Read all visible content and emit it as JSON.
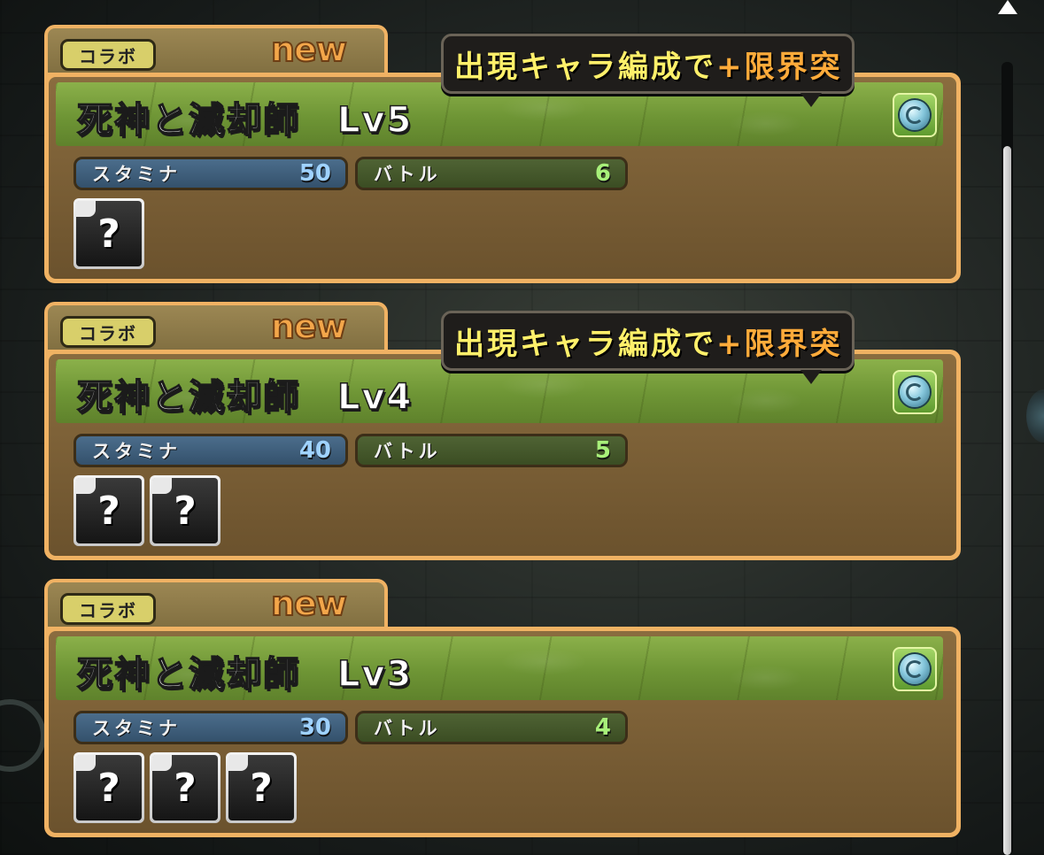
{
  "quests": [
    {
      "collab_label": "コラボ",
      "new_label": "new",
      "title": "死神と滅却師　Lv5",
      "tooltip_part1": "出現キャラ編成で",
      "tooltip_part2": "+限界突",
      "stamina_label": "スタミナ",
      "stamina_value": "50",
      "battle_label": "バトル",
      "battle_value": "6",
      "drops": [
        "?"
      ]
    },
    {
      "collab_label": "コラボ",
      "new_label": "new",
      "title": "死神と滅却師　Lv4",
      "tooltip_part1": "出現キャラ編成で",
      "tooltip_part2": "+限界突",
      "stamina_label": "スタミナ",
      "stamina_value": "40",
      "battle_label": "バトル",
      "battle_value": "5",
      "drops": [
        "?",
        "?"
      ]
    },
    {
      "collab_label": "コラボ",
      "new_label": "new",
      "title": "死神と滅却師　Lv3",
      "stamina_label": "スタミナ",
      "stamina_value": "30",
      "battle_label": "バトル",
      "battle_value": "4",
      "drops": [
        "?",
        "?",
        "?"
      ]
    }
  ],
  "colors": {
    "card_border": "#f0b263",
    "title_band": "#7aa23f",
    "stamina_bar": "#3f5f7e",
    "battle_bar": "#44582b",
    "new_text": "#f3a64a",
    "tooltip_yellow": "#fff06a",
    "tooltip_orange": "#ffab3a"
  },
  "icons": {
    "attribute": "wood-water-attribute-icon",
    "scroll_up": "triangle-up-icon",
    "unknown_drop": "question-mark-icon"
  }
}
